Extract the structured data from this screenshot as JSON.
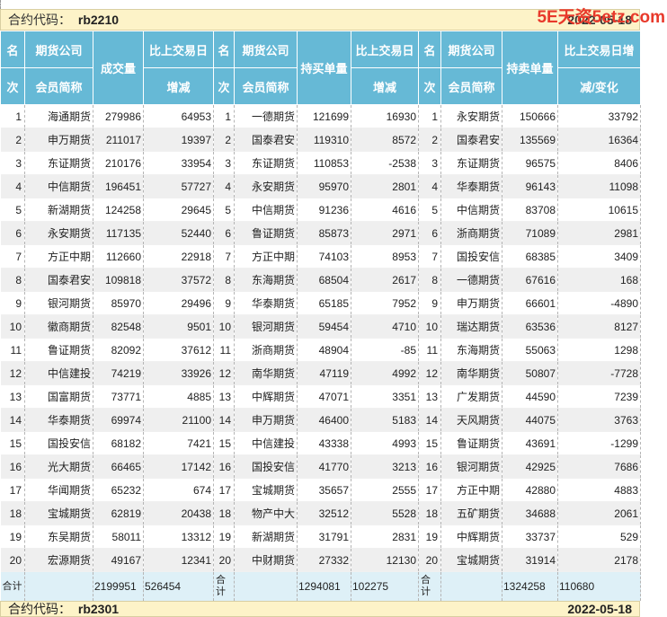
{
  "watermark": "5E天资5etz.com",
  "contract": {
    "label": "合约代码：",
    "code": "rb2210",
    "date": "2022-05-18"
  },
  "next_contract": {
    "label": "合约代码：",
    "code": "rb2301",
    "date": "2022-05-18"
  },
  "headers": {
    "rank_top": "名",
    "rank_bottom": "次",
    "firm_top": "期货公司",
    "firm_bottom": "会员简称",
    "volume": "成交量",
    "change_top": "比上交易日",
    "change_bottom": "增减",
    "long": "持买单量",
    "short": "持卖单量",
    "change3_top": "比上交易日增",
    "change3_bottom": "减/变化"
  },
  "rows": [
    {
      "r": "1",
      "v_firm": "海通期货",
      "v_vol": "279986",
      "v_chg": "64953",
      "l_rank": "1",
      "l_firm": "一德期货",
      "l_vol": "121699",
      "l_chg": "16930",
      "s_rank": "1",
      "s_firm": "永安期货",
      "s_vol": "150666",
      "s_chg": "33792"
    },
    {
      "r": "2",
      "v_firm": "申万期货",
      "v_vol": "211017",
      "v_chg": "19397",
      "l_rank": "2",
      "l_firm": "国泰君安",
      "l_vol": "119310",
      "l_chg": "8572",
      "s_rank": "2",
      "s_firm": "国泰君安",
      "s_vol": "135569",
      "s_chg": "16364"
    },
    {
      "r": "3",
      "v_firm": "东证期货",
      "v_vol": "210176",
      "v_chg": "33954",
      "l_rank": "3",
      "l_firm": "东证期货",
      "l_vol": "110853",
      "l_chg": "-2538",
      "s_rank": "3",
      "s_firm": "东证期货",
      "s_vol": "96575",
      "s_chg": "8406"
    },
    {
      "r": "4",
      "v_firm": "中信期货",
      "v_vol": "196451",
      "v_chg": "57727",
      "l_rank": "4",
      "l_firm": "永安期货",
      "l_vol": "95970",
      "l_chg": "2801",
      "s_rank": "4",
      "s_firm": "华泰期货",
      "s_vol": "96143",
      "s_chg": "11098"
    },
    {
      "r": "5",
      "v_firm": "新湖期货",
      "v_vol": "124258",
      "v_chg": "29645",
      "l_rank": "5",
      "l_firm": "中信期货",
      "l_vol": "91236",
      "l_chg": "4616",
      "s_rank": "5",
      "s_firm": "中信期货",
      "s_vol": "83708",
      "s_chg": "10615"
    },
    {
      "r": "6",
      "v_firm": "永安期货",
      "v_vol": "117135",
      "v_chg": "52440",
      "l_rank": "6",
      "l_firm": "鲁证期货",
      "l_vol": "85873",
      "l_chg": "2971",
      "s_rank": "6",
      "s_firm": "浙商期货",
      "s_vol": "71089",
      "s_chg": "2981"
    },
    {
      "r": "7",
      "v_firm": "方正中期",
      "v_vol": "112660",
      "v_chg": "22918",
      "l_rank": "7",
      "l_firm": "方正中期",
      "l_vol": "74103",
      "l_chg": "8953",
      "s_rank": "7",
      "s_firm": "国投安信",
      "s_vol": "68385",
      "s_chg": "3409"
    },
    {
      "r": "8",
      "v_firm": "国泰君安",
      "v_vol": "109818",
      "v_chg": "37572",
      "l_rank": "8",
      "l_firm": "东海期货",
      "l_vol": "68504",
      "l_chg": "2617",
      "s_rank": "8",
      "s_firm": "一德期货",
      "s_vol": "67616",
      "s_chg": "168"
    },
    {
      "r": "9",
      "v_firm": "银河期货",
      "v_vol": "85970",
      "v_chg": "29496",
      "l_rank": "9",
      "l_firm": "华泰期货",
      "l_vol": "65185",
      "l_chg": "7952",
      "s_rank": "9",
      "s_firm": "申万期货",
      "s_vol": "66601",
      "s_chg": "-4890"
    },
    {
      "r": "10",
      "v_firm": "徽商期货",
      "v_vol": "82548",
      "v_chg": "9501",
      "l_rank": "10",
      "l_firm": "银河期货",
      "l_vol": "59454",
      "l_chg": "4710",
      "s_rank": "10",
      "s_firm": "瑞达期货",
      "s_vol": "63536",
      "s_chg": "8127"
    },
    {
      "r": "11",
      "v_firm": "鲁证期货",
      "v_vol": "82092",
      "v_chg": "37612",
      "l_rank": "11",
      "l_firm": "浙商期货",
      "l_vol": "48904",
      "l_chg": "-85",
      "s_rank": "11",
      "s_firm": "东海期货",
      "s_vol": "55063",
      "s_chg": "1298"
    },
    {
      "r": "12",
      "v_firm": "中信建投",
      "v_vol": "74219",
      "v_chg": "33926",
      "l_rank": "12",
      "l_firm": "南华期货",
      "l_vol": "47119",
      "l_chg": "4992",
      "s_rank": "12",
      "s_firm": "南华期货",
      "s_vol": "50807",
      "s_chg": "-7728"
    },
    {
      "r": "13",
      "v_firm": "国富期货",
      "v_vol": "73771",
      "v_chg": "4885",
      "l_rank": "13",
      "l_firm": "中辉期货",
      "l_vol": "47071",
      "l_chg": "3351",
      "s_rank": "13",
      "s_firm": "广发期货",
      "s_vol": "44590",
      "s_chg": "7239"
    },
    {
      "r": "14",
      "v_firm": "华泰期货",
      "v_vol": "69974",
      "v_chg": "21100",
      "l_rank": "14",
      "l_firm": "申万期货",
      "l_vol": "46400",
      "l_chg": "5183",
      "s_rank": "14",
      "s_firm": "天风期货",
      "s_vol": "44075",
      "s_chg": "3763"
    },
    {
      "r": "15",
      "v_firm": "国投安信",
      "v_vol": "68182",
      "v_chg": "7421",
      "l_rank": "15",
      "l_firm": "中信建投",
      "l_vol": "43338",
      "l_chg": "4993",
      "s_rank": "15",
      "s_firm": "鲁证期货",
      "s_vol": "43691",
      "s_chg": "-1299"
    },
    {
      "r": "16",
      "v_firm": "光大期货",
      "v_vol": "66465",
      "v_chg": "17142",
      "l_rank": "16",
      "l_firm": "国投安信",
      "l_vol": "41770",
      "l_chg": "3213",
      "s_rank": "16",
      "s_firm": "银河期货",
      "s_vol": "42925",
      "s_chg": "7686"
    },
    {
      "r": "17",
      "v_firm": "华闻期货",
      "v_vol": "65232",
      "v_chg": "674",
      "l_rank": "17",
      "l_firm": "宝城期货",
      "l_vol": "35657",
      "l_chg": "2555",
      "s_rank": "17",
      "s_firm": "方正中期",
      "s_vol": "42880",
      "s_chg": "4883"
    },
    {
      "r": "18",
      "v_firm": "宝城期货",
      "v_vol": "62819",
      "v_chg": "20438",
      "l_rank": "18",
      "l_firm": "物产中大",
      "l_vol": "32512",
      "l_chg": "5528",
      "s_rank": "18",
      "s_firm": "五矿期货",
      "s_vol": "34688",
      "s_chg": "2061"
    },
    {
      "r": "19",
      "v_firm": "东吴期货",
      "v_vol": "58011",
      "v_chg": "13312",
      "l_rank": "19",
      "l_firm": "新湖期货",
      "l_vol": "31791",
      "l_chg": "2831",
      "s_rank": "19",
      "s_firm": "中辉期货",
      "s_vol": "33737",
      "s_chg": "529"
    },
    {
      "r": "20",
      "v_firm": "宏源期货",
      "v_vol": "49167",
      "v_chg": "12341",
      "l_rank": "20",
      "l_firm": "中财期货",
      "l_vol": "27332",
      "l_chg": "12130",
      "s_rank": "20",
      "s_firm": "宝城期货",
      "s_vol": "31914",
      "s_chg": "2178"
    }
  ],
  "totals": {
    "label": "合计",
    "volume": "2199951",
    "volume_change": "526454",
    "long": "1294081",
    "long_change": "102275",
    "short": "1324258",
    "short_change": "110680"
  }
}
